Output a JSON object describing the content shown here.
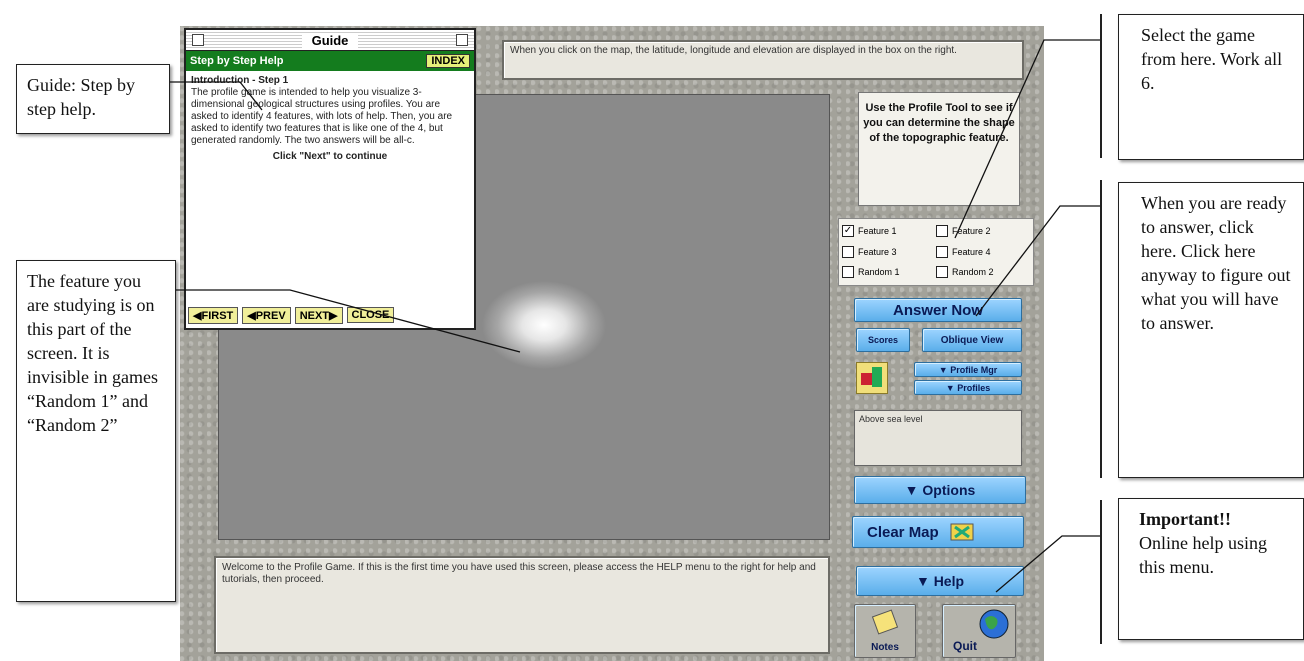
{
  "top_status": "When you click on the map, the latitude, longitude and elevation are displayed in the box on the right.",
  "bottom_status": "Welcome to the Profile Game. If this is the first time you have used this screen, please access the HELP menu to the right for help and tutorials, then proceed.",
  "guide": {
    "title": "Guide",
    "step_label": "Step by Step Help",
    "index_label": "INDEX",
    "heading": "Introduction - Step 1",
    "body": "The profile game is intended to help you visualize 3-dimensional geological structures using profiles. You are asked to identify 4 features, with lots of help. Then, you are asked to identify two features that is like one of the 4, but generated randomly. The two answers will be all-c.",
    "continue_text": "Click \"Next\" to continue",
    "nav": {
      "first": "FIRST",
      "prev": "PREV",
      "next": "NEXT",
      "close": "CLOSE"
    }
  },
  "right_panel": {
    "prompt": "Use the Profile Tool to see if you can determine the shape of the topographic feature.",
    "features": [
      {
        "label": "Feature 1",
        "checked": true
      },
      {
        "label": "Feature 2",
        "checked": false
      },
      {
        "label": "Feature 3",
        "checked": false
      },
      {
        "label": "Feature 4",
        "checked": false
      },
      {
        "label": "Random 1",
        "checked": false
      },
      {
        "label": "Random 2",
        "checked": false
      }
    ],
    "answer_now": "Answer Now",
    "scores": "Scores",
    "oblique_view": "Oblique View",
    "profile_mgr": "▼ Profile Mgr",
    "profiles": "▼ Profiles",
    "mini_status": "Above sea level",
    "options": "▼ Options",
    "clear_map": "Clear Map",
    "help": "▼ Help",
    "notes": "Notes",
    "quit": "Quit"
  },
  "callouts": {
    "guide": "Guide: Step by step help.",
    "feature": "The feature you are studying is on this part of the screen. It is invisible in games “Random 1” and “Random 2”",
    "select": "Select the game from here. Work all 6.",
    "answer": "When you are ready to answer, click here. Click here anyway to figure out what you will have to answer.",
    "important_bold": "Important!!",
    "important_rest": "Online help using this menu."
  },
  "colors": {
    "button_blue": "#7cc3f6",
    "guide_green": "#147c1e",
    "panel_gray": "#a3a29a"
  }
}
